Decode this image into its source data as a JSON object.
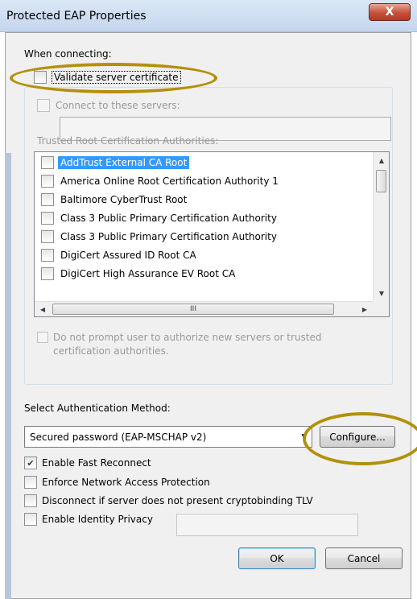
{
  "window": {
    "title": "Protected EAP Properties",
    "close_glyph": "X"
  },
  "connect": {
    "heading": "When connecting:",
    "validate_cert": {
      "label": "Validate server certificate",
      "checked": false
    },
    "connect_servers": {
      "label": "Connect to these servers:",
      "checked": false,
      "value": ""
    },
    "trusted_heading": "Trusted Root Certification Authorities:",
    "authorities": [
      {
        "label": "AddTrust External CA Root",
        "checked": false,
        "selected": true
      },
      {
        "label": "America Online Root Certification Authority 1",
        "checked": false
      },
      {
        "label": "Baltimore CyberTrust Root",
        "checked": false
      },
      {
        "label": "Class 3 Public Primary Certification Authority",
        "checked": false
      },
      {
        "label": "Class 3 Public Primary Certification Authority",
        "checked": false
      },
      {
        "label": "DigiCert Assured ID Root CA",
        "checked": false
      },
      {
        "label": "DigiCert High Assurance EV Root CA",
        "checked": false
      }
    ],
    "scroll_thumb_glyph": "III",
    "do_not_prompt": {
      "line1": "Do not prompt user to authorize new servers or trusted",
      "line2": "certification authorities.",
      "checked": false
    }
  },
  "auth": {
    "heading": "Select Authentication Method:",
    "method_selected": "Secured password (EAP-MSCHAP v2)",
    "configure_label": "Configure..."
  },
  "options": {
    "fast_reconnect": {
      "label": "Enable Fast Reconnect",
      "checked": true
    },
    "nap": {
      "label": "Enforce Network Access Protection",
      "checked": false
    },
    "disconnect_tlv": {
      "label": "Disconnect if server does not present cryptobinding TLV",
      "checked": false
    },
    "identity_privacy": {
      "label": "Enable Identity Privacy",
      "checked": false,
      "value": ""
    }
  },
  "buttons": {
    "ok": "OK",
    "cancel": "Cancel"
  },
  "icons": {
    "check": "✔",
    "arrow_up": "▲",
    "arrow_down": "▼",
    "arrow_left": "◀",
    "arrow_right": "▶",
    "combo_arrow": "▼"
  },
  "colors": {
    "selection": "#3399ff",
    "annotation": "#b3900a",
    "close": "#c7503a"
  }
}
